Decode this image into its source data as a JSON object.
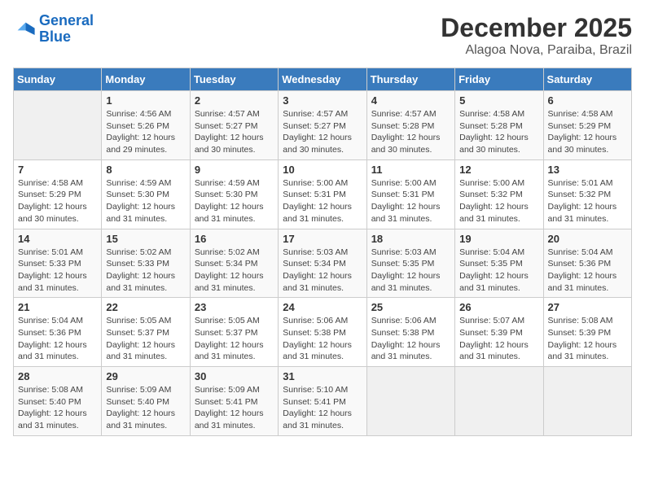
{
  "header": {
    "logo_line1": "General",
    "logo_line2": "Blue",
    "month_title": "December 2025",
    "location": "Alagoa Nova, Paraiba, Brazil"
  },
  "days_of_week": [
    "Sunday",
    "Monday",
    "Tuesday",
    "Wednesday",
    "Thursday",
    "Friday",
    "Saturday"
  ],
  "weeks": [
    [
      {
        "day": "",
        "info": ""
      },
      {
        "day": "1",
        "info": "Sunrise: 4:56 AM\nSunset: 5:26 PM\nDaylight: 12 hours\nand 29 minutes."
      },
      {
        "day": "2",
        "info": "Sunrise: 4:57 AM\nSunset: 5:27 PM\nDaylight: 12 hours\nand 30 minutes."
      },
      {
        "day": "3",
        "info": "Sunrise: 4:57 AM\nSunset: 5:27 PM\nDaylight: 12 hours\nand 30 minutes."
      },
      {
        "day": "4",
        "info": "Sunrise: 4:57 AM\nSunset: 5:28 PM\nDaylight: 12 hours\nand 30 minutes."
      },
      {
        "day": "5",
        "info": "Sunrise: 4:58 AM\nSunset: 5:28 PM\nDaylight: 12 hours\nand 30 minutes."
      },
      {
        "day": "6",
        "info": "Sunrise: 4:58 AM\nSunset: 5:29 PM\nDaylight: 12 hours\nand 30 minutes."
      }
    ],
    [
      {
        "day": "7",
        "info": "Sunrise: 4:58 AM\nSunset: 5:29 PM\nDaylight: 12 hours\nand 30 minutes."
      },
      {
        "day": "8",
        "info": "Sunrise: 4:59 AM\nSunset: 5:30 PM\nDaylight: 12 hours\nand 31 minutes."
      },
      {
        "day": "9",
        "info": "Sunrise: 4:59 AM\nSunset: 5:30 PM\nDaylight: 12 hours\nand 31 minutes."
      },
      {
        "day": "10",
        "info": "Sunrise: 5:00 AM\nSunset: 5:31 PM\nDaylight: 12 hours\nand 31 minutes."
      },
      {
        "day": "11",
        "info": "Sunrise: 5:00 AM\nSunset: 5:31 PM\nDaylight: 12 hours\nand 31 minutes."
      },
      {
        "day": "12",
        "info": "Sunrise: 5:00 AM\nSunset: 5:32 PM\nDaylight: 12 hours\nand 31 minutes."
      },
      {
        "day": "13",
        "info": "Sunrise: 5:01 AM\nSunset: 5:32 PM\nDaylight: 12 hours\nand 31 minutes."
      }
    ],
    [
      {
        "day": "14",
        "info": "Sunrise: 5:01 AM\nSunset: 5:33 PM\nDaylight: 12 hours\nand 31 minutes."
      },
      {
        "day": "15",
        "info": "Sunrise: 5:02 AM\nSunset: 5:33 PM\nDaylight: 12 hours\nand 31 minutes."
      },
      {
        "day": "16",
        "info": "Sunrise: 5:02 AM\nSunset: 5:34 PM\nDaylight: 12 hours\nand 31 minutes."
      },
      {
        "day": "17",
        "info": "Sunrise: 5:03 AM\nSunset: 5:34 PM\nDaylight: 12 hours\nand 31 minutes."
      },
      {
        "day": "18",
        "info": "Sunrise: 5:03 AM\nSunset: 5:35 PM\nDaylight: 12 hours\nand 31 minutes."
      },
      {
        "day": "19",
        "info": "Sunrise: 5:04 AM\nSunset: 5:35 PM\nDaylight: 12 hours\nand 31 minutes."
      },
      {
        "day": "20",
        "info": "Sunrise: 5:04 AM\nSunset: 5:36 PM\nDaylight: 12 hours\nand 31 minutes."
      }
    ],
    [
      {
        "day": "21",
        "info": "Sunrise: 5:04 AM\nSunset: 5:36 PM\nDaylight: 12 hours\nand 31 minutes."
      },
      {
        "day": "22",
        "info": "Sunrise: 5:05 AM\nSunset: 5:37 PM\nDaylight: 12 hours\nand 31 minutes."
      },
      {
        "day": "23",
        "info": "Sunrise: 5:05 AM\nSunset: 5:37 PM\nDaylight: 12 hours\nand 31 minutes."
      },
      {
        "day": "24",
        "info": "Sunrise: 5:06 AM\nSunset: 5:38 PM\nDaylight: 12 hours\nand 31 minutes."
      },
      {
        "day": "25",
        "info": "Sunrise: 5:06 AM\nSunset: 5:38 PM\nDaylight: 12 hours\nand 31 minutes."
      },
      {
        "day": "26",
        "info": "Sunrise: 5:07 AM\nSunset: 5:39 PM\nDaylight: 12 hours\nand 31 minutes."
      },
      {
        "day": "27",
        "info": "Sunrise: 5:08 AM\nSunset: 5:39 PM\nDaylight: 12 hours\nand 31 minutes."
      }
    ],
    [
      {
        "day": "28",
        "info": "Sunrise: 5:08 AM\nSunset: 5:40 PM\nDaylight: 12 hours\nand 31 minutes."
      },
      {
        "day": "29",
        "info": "Sunrise: 5:09 AM\nSunset: 5:40 PM\nDaylight: 12 hours\nand 31 minutes."
      },
      {
        "day": "30",
        "info": "Sunrise: 5:09 AM\nSunset: 5:41 PM\nDaylight: 12 hours\nand 31 minutes."
      },
      {
        "day": "31",
        "info": "Sunrise: 5:10 AM\nSunset: 5:41 PM\nDaylight: 12 hours\nand 31 minutes."
      },
      {
        "day": "",
        "info": ""
      },
      {
        "day": "",
        "info": ""
      },
      {
        "day": "",
        "info": ""
      }
    ]
  ]
}
